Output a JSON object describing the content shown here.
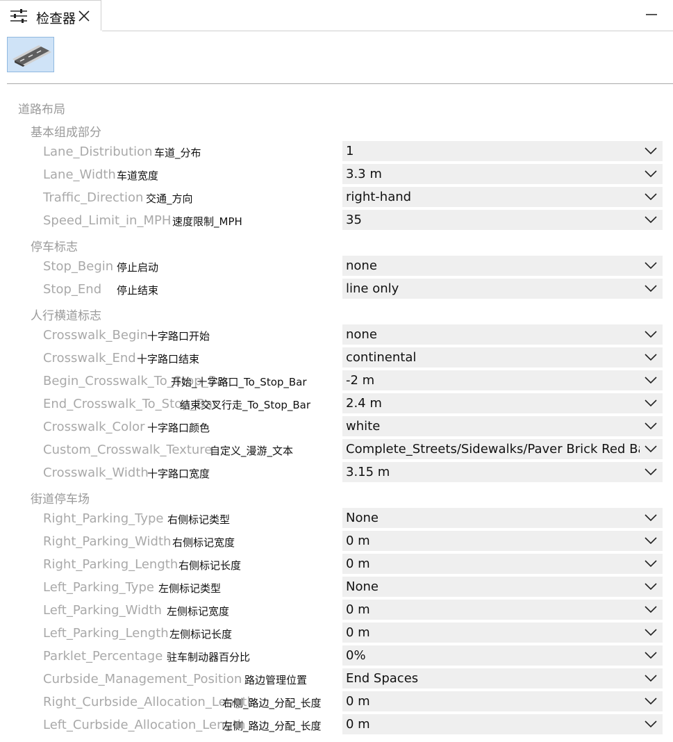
{
  "tab": {
    "title": "检查器"
  },
  "sections": [
    {
      "title": "道路布局"
    },
    {
      "title": "基本组成部分"
    },
    {
      "title": "停车标志"
    },
    {
      "title": "人行横道标志"
    },
    {
      "title": "街道停车场"
    }
  ],
  "rows": [
    {
      "label": "Lane_Distribution",
      "alias": "车道_分布",
      "value": "1"
    },
    {
      "label": "Lane_Width",
      "alias": "车道宽度",
      "value": "3.3 m"
    },
    {
      "label": "Traffic_Direction",
      "alias": "交通_方向",
      "value": "right-hand"
    },
    {
      "label": "Speed_Limit_in_MPH",
      "alias": "速度限制_MPH",
      "value": "35"
    },
    {
      "label": "Stop_Begin",
      "alias": "停止启动",
      "value": "none"
    },
    {
      "label": "Stop_End",
      "alias": "停止结束",
      "value": "line only"
    },
    {
      "label": "Crosswalk_Begin",
      "alias": "十字路口开始",
      "value": "none"
    },
    {
      "label": "Crosswalk_End",
      "alias": "十字路口结束",
      "value": "continental"
    },
    {
      "label": "Begin_Crosswalk_To_Stop_Bar",
      "alias": "开始_十字路口_To_Stop_Bar",
      "value": "-2 m"
    },
    {
      "label": "End_Crosswalk_To_Stop_Bar",
      "alias": "结束交叉行走_To_Stop_Bar",
      "value": "2.4 m"
    },
    {
      "label": "Crosswalk_Color",
      "alias": "十字路口颜色",
      "value": "white"
    },
    {
      "label": "Custom_Crosswalk_Texture",
      "alias": "自定义_漫游_文本",
      "value": "Complete_Streets/Sidewalks/Paver Brick Red Basket.jpg"
    },
    {
      "label": "Crosswalk_Width",
      "alias": "十字路口宽度",
      "value": "3.15 m"
    },
    {
      "label": "Right_Parking_Type",
      "alias": "右侧标记类型",
      "value": "None"
    },
    {
      "label": "Right_Parking_Width",
      "alias": "右侧标记宽度",
      "value": "0 m"
    },
    {
      "label": "Right_Parking_Length",
      "alias": "右侧标记长度",
      "value": "0 m"
    },
    {
      "label": "Left_Parking_Type",
      "alias": "左侧标记类型",
      "value": "None"
    },
    {
      "label": "Left_Parking_Width",
      "alias": "左侧标记宽度",
      "value": "0 m"
    },
    {
      "label": "Left_Parking_Length",
      "alias": "左侧标记长度",
      "value": "0 m"
    },
    {
      "label": "Parklet_Percentage",
      "alias": "驻车制动器百分比",
      "value": "0%"
    },
    {
      "label": "Curbside_Management_Position",
      "alias": "路边管理位置",
      "value": "End Spaces"
    },
    {
      "label": "Right_Curbside_Allocation_Length",
      "alias": "右侧_路边_分配_长度",
      "value": "0 m"
    },
    {
      "label": "Left_Curbside_Allocation_Length",
      "alias": "左侧_路边_分配_长度",
      "value": "0 m"
    }
  ]
}
